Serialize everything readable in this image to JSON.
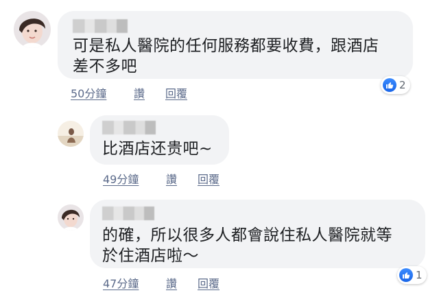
{
  "comments": [
    {
      "text": "可是私人醫院的任何服務都要收費，跟酒店\n差不多吧",
      "time": "50分鐘",
      "like_label": "讚",
      "reply_label": "回覆",
      "reaction_count": "2",
      "reaction_icon": "thumbs-up-icon"
    },
    {
      "text": "比酒店还贵吧~",
      "time": "49分鐘",
      "like_label": "讚",
      "reply_label": "回覆"
    },
    {
      "text": "的確，所以很多人都會說住私人醫院就等\n於住酒店啦～",
      "time": "47分鐘",
      "like_label": "讚",
      "reply_label": "回覆",
      "reaction_count": "1",
      "reaction_icon": "thumbs-up-icon"
    }
  ],
  "colors": {
    "bubble": "#f2f3f5",
    "action_link": "#5b6a8a",
    "like_blue": "#1a66e8"
  }
}
